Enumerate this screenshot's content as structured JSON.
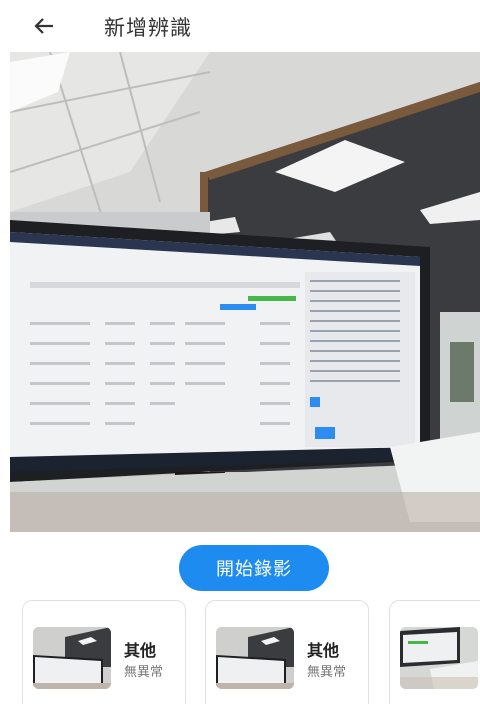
{
  "header": {
    "title": "新增辨識",
    "back_icon": "arrow-left-icon"
  },
  "preview": {
    "icon": "camera-preview"
  },
  "actions": {
    "record_label": "開始錄影",
    "record_color": "#1e8bf0"
  },
  "results": [
    {
      "category": "其他",
      "status": "無異常"
    },
    {
      "category": "其他",
      "status": "無異常"
    },
    {
      "category": "",
      "status": ""
    }
  ]
}
